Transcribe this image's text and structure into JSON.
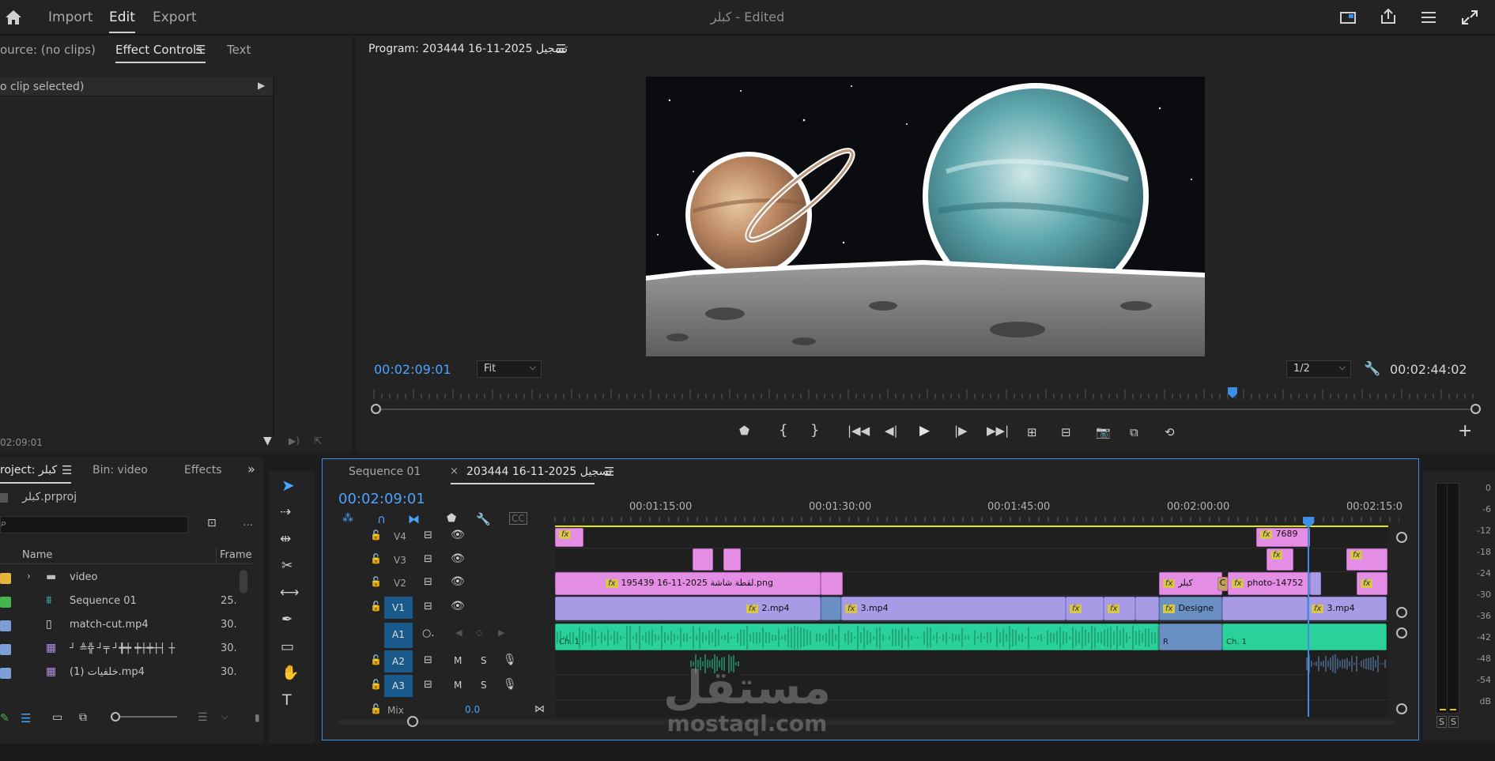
{
  "topbar": {
    "tabs": [
      "Import",
      "Edit",
      "Export"
    ],
    "active_tab": "Edit",
    "title_name": "كبلر",
    "title_suffix": "- Edited"
  },
  "source_panel": {
    "tabs": [
      "ource: (no clips)",
      "Effect Controls",
      "Text"
    ],
    "active_tab": "Effect Controls",
    "no_clip": "o clip selected)",
    "timecode": "02:09:01"
  },
  "program_monitor": {
    "title": "Program: 203444 16-11-2025 تسجيل",
    "timecode_current": "00:02:09:01",
    "fit": "Fit",
    "resolution": "1/2",
    "timecode_duration": "00:02:44:02",
    "playhead_fraction": 0.78
  },
  "project_panel": {
    "tabs": [
      "roject: كبلر",
      "Bin: video",
      "Effects"
    ],
    "project_file": "كبلر.prproj",
    "search_placeholder": "",
    "col_name": "Name",
    "col_frame": "Frame",
    "items": [
      {
        "name": "video",
        "frame": "",
        "color": "#e3b63b",
        "kind": "folder"
      },
      {
        "name": "Sequence 01",
        "frame": "25.",
        "color": "#45b54e",
        "kind": "sequence"
      },
      {
        "name": "match-cut.mp4",
        "frame": "30.",
        "color": "#7b9fd6",
        "kind": "file"
      },
      {
        "name": "┘ ≜╬ ┘╤ ┘╋┿ ┿┼┿┼┤ ┼",
        "frame": "30.",
        "color": "#7b9fd6",
        "kind": "video"
      },
      {
        "name": "خلفيات (1).mp4",
        "frame": "30.",
        "color": "#7b9fd6",
        "kind": "video"
      }
    ]
  },
  "timeline": {
    "tabs": [
      "Sequence 01",
      "203444 16-11-2025 تسجيل"
    ],
    "active_tab": "203444 16-11-2025 تسجيل",
    "timecode": "00:02:09:01",
    "ruler": [
      "00:01:15:00",
      "00:01:30:00",
      "00:01:45:00",
      "00:02:00:00",
      "00:02:15:0"
    ],
    "tracks": [
      "V4",
      "V3",
      "V2",
      "V1",
      "A1",
      "A2",
      "A3"
    ],
    "mix_label": "Mix",
    "mix_value": "0.0",
    "clips": {
      "v2_main": "لقطة شاشة 2025-11-16 195439.png",
      "v2_b": "كبلر",
      "v2_c": "photo-14752",
      "v1_a": "2.mp4",
      "v1_b": "3.mp4",
      "v1_c": "Designe",
      "v1_d": "3.mp4",
      "v4_label": "7689",
      "a1_a": "Ch. 1",
      "a1_b": "Ch. 1",
      "a1_r": "R",
      "c_label": "C"
    },
    "track_buttons": {
      "m": "M",
      "s": "S"
    }
  },
  "meter": {
    "scale": [
      "0",
      "-6",
      "-12",
      "-18",
      "-24",
      "-30",
      "-36",
      "-42",
      "-48",
      "-54",
      "dB"
    ],
    "solo": [
      "S",
      "S"
    ]
  },
  "watermark": {
    "main": "مستقل",
    "sub": "mostaql.com"
  }
}
